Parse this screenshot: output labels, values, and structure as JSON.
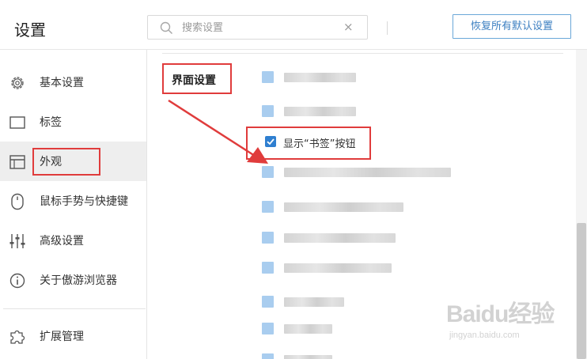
{
  "header": {
    "title": "设置",
    "search_placeholder": "搜索设置",
    "clear_glyph": "×",
    "restore_label": "恢复所有默认设置"
  },
  "sidebar": {
    "items": [
      {
        "label": "基本设置",
        "icon": "gear-icon"
      },
      {
        "label": "标签",
        "icon": "tab-icon"
      },
      {
        "label": "外观",
        "icon": "window-icon",
        "active": true
      },
      {
        "label": "鼠标手势与快捷键",
        "icon": "mouse-icon"
      },
      {
        "label": "高级设置",
        "icon": "sliders-icon"
      },
      {
        "label": "关于傲游浏览器",
        "icon": "info-icon"
      },
      {
        "label": "扩展管理",
        "icon": "puzzle-icon"
      }
    ]
  },
  "main": {
    "section_title": "界面设置",
    "show_bookmark_button": {
      "label": "显示“书签”按钮",
      "checked": true
    }
  },
  "colors": {
    "accent": "#2f7fd0",
    "annotation": "#e03c3c",
    "active_nav_bg": "#eeeeee"
  },
  "watermark": {
    "logo": "Baidu经验",
    "url": "jingyan.baidu.com"
  }
}
